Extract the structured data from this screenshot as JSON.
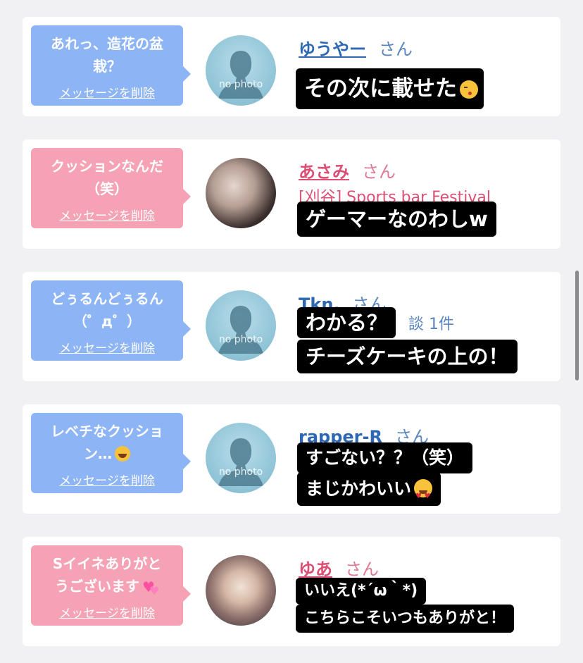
{
  "colors": {
    "blue_bubble": "#8db4f4",
    "pink_bubble": "#f5a3b4",
    "blue_name": "#2f68b2",
    "pink_name": "#dc4f74",
    "caption_bg": "#000000"
  },
  "delete_label": "メッセージを削除",
  "no_photo_label": "no photo",
  "cards": [
    {
      "bubble_color": "blue",
      "message": "あれっ、造花の盆\n栽？",
      "avatar": "no-photo",
      "username": "ゆうやー",
      "san": "さん",
      "caption_lines": [
        "その次に載せた"
      ],
      "caption_emoji": "kissing-face-icon"
    },
    {
      "bubble_color": "pink",
      "message": "クッションなんだ\n（笑）",
      "avatar": "photo",
      "username": "あさみ",
      "san": "さん",
      "subtitle": "[刈谷] Sports bar Festival",
      "caption_lines": [
        "ゲーマーなのわしw"
      ]
    },
    {
      "bubble_color": "blue",
      "message": "どぅるんどぅるん\n（゜д゜）",
      "avatar": "no-photo",
      "username": "Tkn.",
      "san": "さん",
      "faint_text": "談 1件",
      "caption_lines": [
        "わかる？",
        "チーズケーキの上の！"
      ]
    },
    {
      "bubble_color": "blue",
      "message": "レベチなクッショ\nン…",
      "message_emoji": "laughing-tears-icon",
      "avatar": "no-photo",
      "username": "rapper-R",
      "san": "さん",
      "caption_lines": [
        "すごない？？（笑）",
        "まじかわいい"
      ],
      "caption_emoji": "heart-eyes-icon"
    },
    {
      "bubble_color": "pink",
      "message": "Sイイネありがと\nうございます",
      "message_emoji": "two-hearts-icon",
      "avatar": "photo",
      "username": "ゆあ",
      "san": "さん",
      "caption_lines": [
        "いいえ(*´ω｀*)",
        "こちらこそいつもありがと！"
      ]
    }
  ]
}
